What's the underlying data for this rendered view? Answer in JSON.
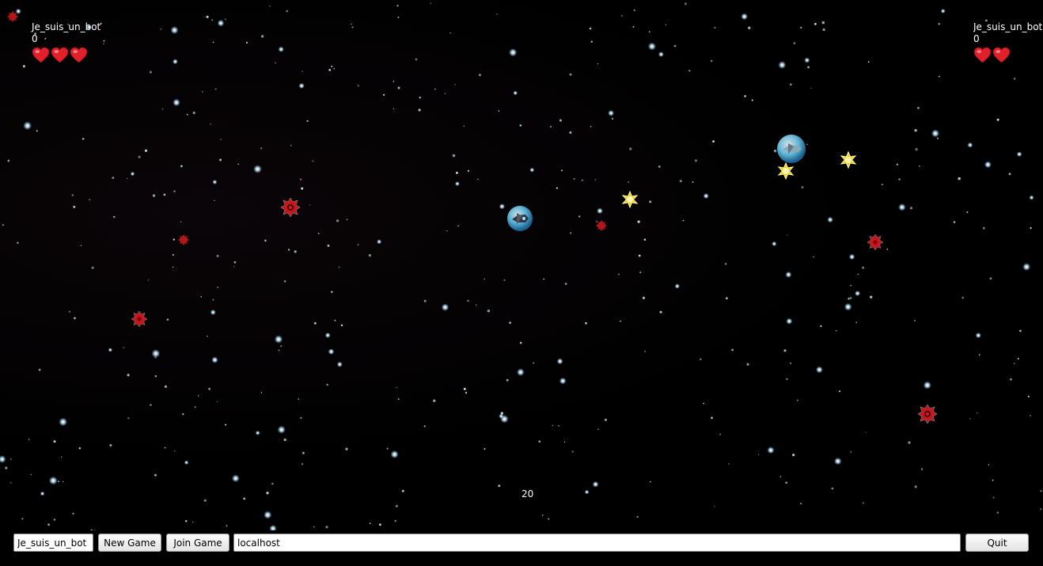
{
  "player_left": {
    "name": "Je_suis_un_bot",
    "score": "0",
    "lives": 3
  },
  "player_right": {
    "name": "Je_suis_un_bot",
    "score": "0",
    "lives": 2
  },
  "timer": "20",
  "controls": {
    "name_value": "Je_suis_un_bot",
    "new_game_label": "New Game",
    "join_game_label": "Join Game",
    "host_value": "localhost",
    "quit_label": "Quit"
  },
  "colors": {
    "background": "#000000",
    "heart": "#e0202a",
    "mine": "#c8141c",
    "bonus": "#f5d020",
    "ship_bubble": "#5cc0e8"
  }
}
